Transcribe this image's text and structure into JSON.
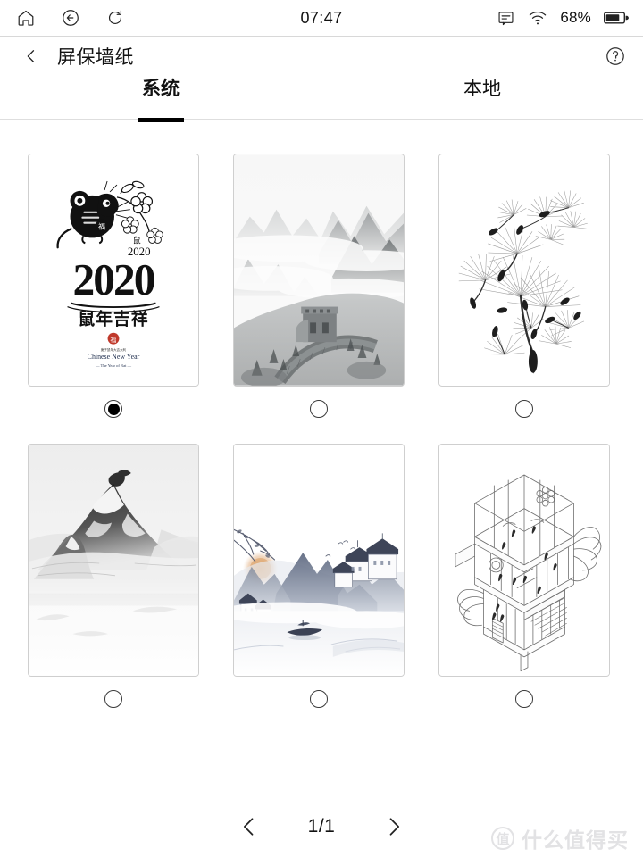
{
  "statusbar": {
    "home_icon": "home-icon",
    "back_icon": "back-circle-icon",
    "refresh_icon": "refresh-icon",
    "clock": "07:47",
    "notes_icon": "note-icon",
    "wifi_icon": "wifi-icon",
    "battery_percent": "68%",
    "battery_icon": "battery-icon",
    "battery_level": 68
  },
  "titlebar": {
    "back_icon": "chevron-left-icon",
    "title": "屏保墙纸",
    "help_icon": "question-circle-icon"
  },
  "tabs": [
    {
      "label": "系统",
      "active": true
    },
    {
      "label": "本地",
      "active": false
    }
  ],
  "wallpapers": [
    {
      "name": "chinese-new-year-2020-rat",
      "alt": "2020 鼠年吉祥 Chinese New Year",
      "caption_big": "2020",
      "caption_cn": "鼠年吉祥",
      "caption_en": "Chinese New Year",
      "caption_en_sub": "The Year of Rat",
      "badge_year": "2020",
      "badge_cn": "鼠",
      "selected": true
    },
    {
      "name": "great-wall-ink-mountains",
      "alt": "长城云海 Great Wall in misty mountains",
      "selected": false
    },
    {
      "name": "dandelion-seeds-sketch",
      "alt": "蒲公英 Dandelion seeds line art",
      "selected": false
    },
    {
      "name": "snow-mountain-peak",
      "alt": "雪山 Snowy mountain peak",
      "selected": false
    },
    {
      "name": "ink-village-boat-sunrise",
      "alt": "水墨江南 Ink painting village with boat",
      "selected": false
    },
    {
      "name": "isometric-house-line-art",
      "alt": "等距小屋 Isometric house line drawing",
      "selected": false
    }
  ],
  "pager": {
    "prev_icon": "chevron-left-icon",
    "next_icon": "chevron-right-icon",
    "current": "1/1"
  },
  "watermark": {
    "badge": "值",
    "text": "什么值得买"
  },
  "colors": {
    "accent": "#000000",
    "border": "#cfcfcf",
    "text": "#111111",
    "watermark": "#e2e2e4"
  }
}
